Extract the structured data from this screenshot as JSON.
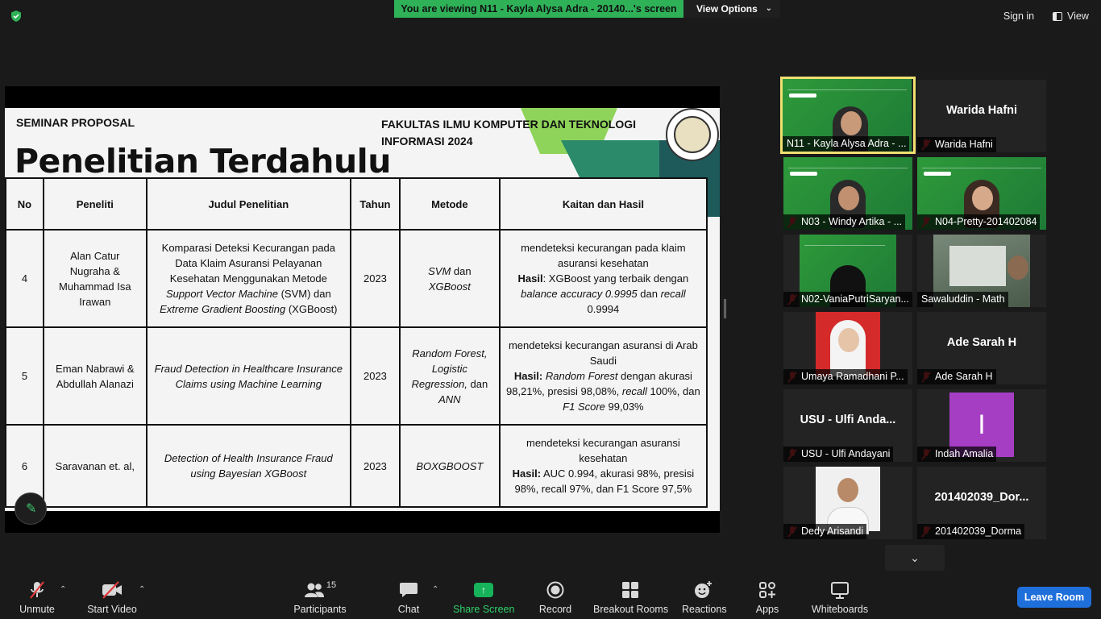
{
  "topbar": {
    "viewing_text": "You are viewing N11 - Kayla Alysa Adra - 20140...'s screen",
    "view_options": "View Options",
    "sign_in": "Sign in",
    "view": "View"
  },
  "slide": {
    "label": "SEMINAR PROPOSAL",
    "faculty": "FAKULTAS ILMU KOMPUTER DAN TEKNOLOGI INFORMASI 2024",
    "title": "Penelitian Terdahulu",
    "headers": [
      "No",
      "Peneliti",
      "Judul Penelitian",
      "Tahun",
      "Metode",
      "Kaitan dan Hasil"
    ],
    "rows": [
      {
        "no": "4",
        "peneliti": "Alan Catur Nugraha & Muhammad Isa Irawan",
        "judul_1": "Komparasi Deteksi Kecurangan pada Data Klaim Asuransi Pelayanan Kesehatan Menggunakan Metode ",
        "judul_2": "Support Vector Machine",
        "judul_3": " (SVM) dan ",
        "judul_4": "Extreme Gradient Boosting",
        "judul_5": " (XGBoost)",
        "tahun": "2023",
        "metode_1": "SVM",
        "metode_2": " dan ",
        "metode_3": "XGBoost",
        "hasil_intro": "mendeteksi kecurangan pada klaim asuransi kesehatan",
        "hasil_label": "Hasil",
        "hasil_1": ": XGBoost yang terbaik dengan ",
        "hasil_2": "balance accuracy 0.9995",
        "hasil_3": " dan ",
        "hasil_4": "recall",
        "hasil_5": " 0.9994"
      },
      {
        "no": "5",
        "peneliti": "Eman Nabrawi & Abdullah Alanazi",
        "judul": "Fraud Detection in Healthcare Insurance Claims using Machine Learning",
        "tahun": "2023",
        "metode_1": "Random Forest, Logistic Regression,",
        "metode_2": "  dan ",
        "metode_3": "ANN",
        "hasil_intro": "mendeteksi kecurangan asuransi di Arab Saudi",
        "hasil_label": "Hasil:",
        "hasil_1": " ",
        "hasil_2": "Random Forest",
        "hasil_3": " dengan akurasi 98,21%, presisi 98,08%, ",
        "hasil_4": "recall",
        "hasil_5": " 100%, dan ",
        "hasil_6": "F1 Score",
        "hasil_7": " 99,03%"
      },
      {
        "no": "6",
        "peneliti": "Saravanan et. al,",
        "judul": "Detection of Health Insurance Fraud using Bayesian XGBoost",
        "tahun": "2023",
        "metode": "BOXGBOOST",
        "hasil_intro": "mendeteksi kecurangan asuransi kesehatan",
        "hasil_label": "Hasil:",
        "hasil_1": "  AUC 0.994, akurasi 98%, presisi 98%, recall 97%, dan F1 Score 97,5%"
      }
    ]
  },
  "gallery": {
    "tiles": [
      {
        "label": "N11 - Kayla Alysa Adra - ...",
        "big": ""
      },
      {
        "label": "Warida Hafni",
        "big": "Warida Hafni"
      },
      {
        "label": "N03 - Windy Artika - ...",
        "big": ""
      },
      {
        "label": "N04-Pretty-201402084",
        "big": ""
      },
      {
        "label": "N02-VaniaPutriSaryan...",
        "big": ""
      },
      {
        "label": "Sawaluddin - Math",
        "big": ""
      },
      {
        "label": "Umaya Ramadhani P...",
        "big": ""
      },
      {
        "label": "Ade Sarah H",
        "big": "Ade Sarah H"
      },
      {
        "label": "USU - Ulfi Andayani",
        "big": "USU - Ulfi Anda..."
      },
      {
        "label": "Indah Amalia",
        "big": "I"
      },
      {
        "label": "Dedy Arisandi",
        "big": ""
      },
      {
        "label": "201402039_Dorma",
        "big": "201402039_Dor..."
      }
    ]
  },
  "toolbar": {
    "unmute": "Unmute",
    "start_video": "Start Video",
    "participants": "Participants",
    "participants_count": "15",
    "chat": "Chat",
    "share_screen": "Share Screen",
    "record": "Record",
    "breakout_rooms": "Breakout Rooms",
    "reactions": "Reactions",
    "apps": "Apps",
    "whiteboards": "Whiteboards",
    "leave_room": "Leave Room"
  },
  "colors": {
    "accent_green": "#2fb158",
    "leave_blue": "#1f6fdb",
    "muted_red": "#e0383b",
    "active_speaker": "#f0e070"
  }
}
